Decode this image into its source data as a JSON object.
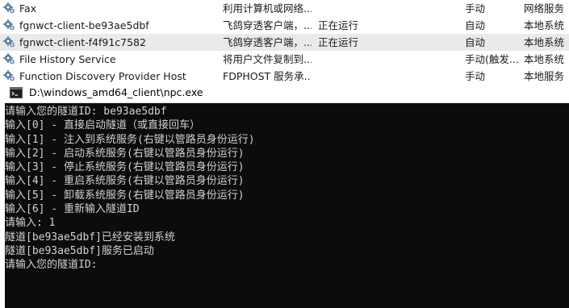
{
  "services": [
    {
      "name": "Fax",
      "description": "利用计算机或网络...",
      "status": "",
      "startup": "手动",
      "logon": "网络服务",
      "selected": false
    },
    {
      "name": "fgnwct-client-be93ae5dbf",
      "description": "飞鸽穿透客户端，...",
      "status": "正在运行",
      "startup": "自动",
      "logon": "本地系统",
      "selected": false
    },
    {
      "name": "fgnwct-client-f4f91c7582",
      "description": "飞鸽穿透客户端，...",
      "status": "正在运行",
      "startup": "自动",
      "logon": "本地系统",
      "selected": true
    },
    {
      "name": "File History Service",
      "description": "将用户文件复制到...",
      "status": "",
      "startup": "手动(触发...",
      "logon": "本地系统",
      "selected": false
    },
    {
      "name": "Function Discovery Provider Host",
      "description": "FDPHOST 服务承...",
      "status": "",
      "startup": "手动",
      "logon": "本地服务",
      "selected": false
    }
  ],
  "console": {
    "title": "D:\\windows_amd64_client\\npc.exe",
    "lines": [
      "请输入您的隧道ID: be93ae5dbf",
      "输入[0] - 直接启动隧道（或直接回车）",
      "输入[1] - 注入到系统服务(右键以管路员身份运行)",
      "输入[2] - 启动系统服务(右键以管路员身份运行)",
      "输入[3] - 停止系统服务(右键以管路员身份运行)",
      "输入[4] - 重启系统服务(右键以管路员身份运行)",
      "输入[5] - 卸载系统服务(右键以管路员身份运行)",
      "输入[6] - 重新输入隧道ID",
      "请输入: 1",
      "隧道[be93ae5dbf]已经安装到系统",
      "隧道[be93ae5dbf]服务已启动",
      "请输入您的隧道ID:"
    ]
  }
}
